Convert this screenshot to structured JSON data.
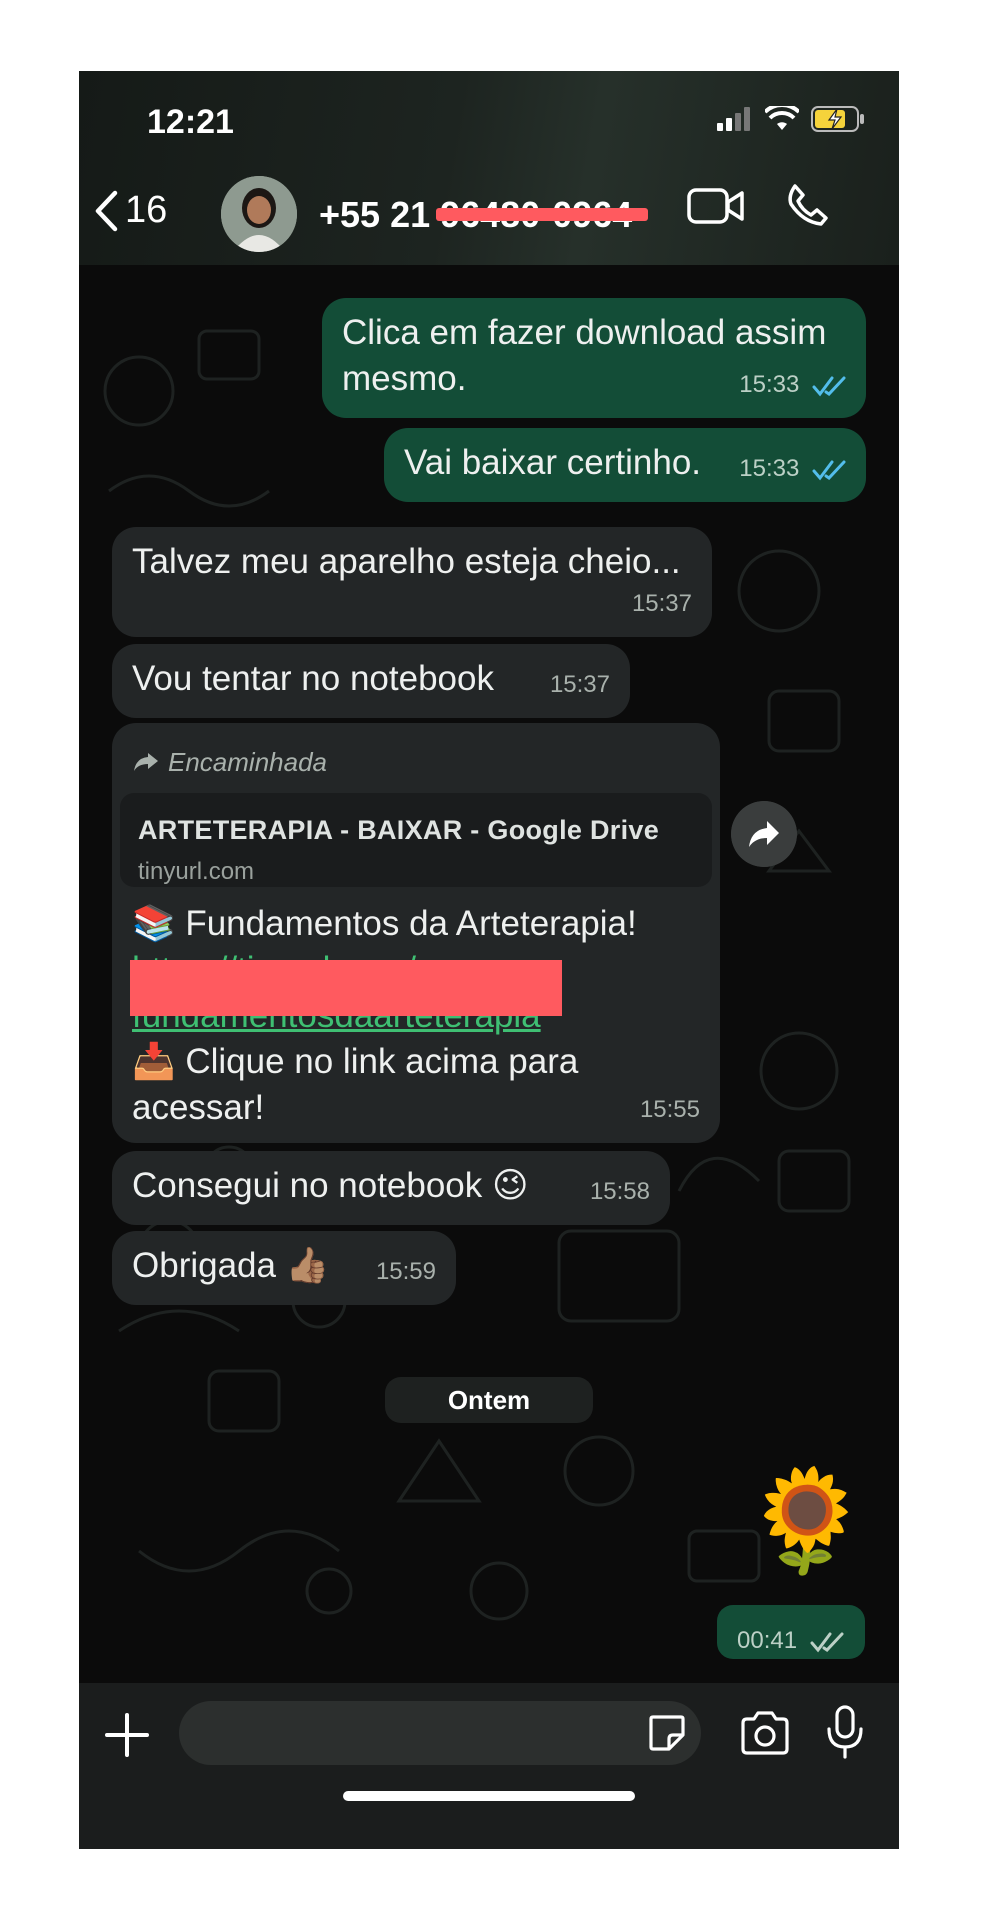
{
  "status_bar": {
    "time": "12:21"
  },
  "header": {
    "back_count": "16",
    "contact_number": "+55 21 96480-0964"
  },
  "messages": [
    {
      "id": "m1",
      "direction": "outgoing",
      "text": "Clica em fazer download assim mesmo.",
      "line1": "Clica em fazer download assim",
      "line2": "mesmo.",
      "time": "15:33"
    },
    {
      "id": "m2",
      "direction": "outgoing",
      "text": "Vai baixar certinho.",
      "time": "15:33"
    },
    {
      "id": "m3",
      "direction": "incoming",
      "text": "Talvez meu aparelho esteja cheio...",
      "time": "15:37"
    },
    {
      "id": "m4",
      "direction": "incoming",
      "text": "Vou tentar no notebook",
      "time": "15:37"
    },
    {
      "id": "m5",
      "direction": "incoming",
      "forwarded_label": "Encaminhada",
      "preview_title": "ARTETERAPIA - BAIXAR - Google Drive",
      "preview_site": "tinyurl.com",
      "book_emoji": "📚",
      "line1": "Fundamentos da Arteterapia!",
      "link_start": "https://tinyurl.com/",
      "link_end": "fundamentosdaarteterapia",
      "inbox_emoji": "📥",
      "line3": "Clique no link acima para",
      "line4": "acessar!",
      "time": "15:55"
    },
    {
      "id": "m6",
      "direction": "incoming",
      "text": "Consegui no notebook",
      "emoji": "😉",
      "time": "15:58"
    },
    {
      "id": "m7",
      "direction": "incoming",
      "text": "Obrigada",
      "emoji": "👍🏽",
      "time": "15:59"
    },
    {
      "id": "m8",
      "direction": "outgoing",
      "sticker": "🌻",
      "time": "00:41"
    }
  ],
  "date_separator": "Ontem",
  "colors": {
    "outgoing_bubble": "#134d37",
    "incoming_bubble": "#232627",
    "read_ticks": "#53bdeb",
    "link": "#3fbf73",
    "redaction": "#ff5a5f"
  },
  "icons": [
    "back-chevron-icon",
    "video-call-icon",
    "phone-icon",
    "share-icon",
    "plus-icon",
    "sticker-icon",
    "camera-icon",
    "mic-icon"
  ]
}
